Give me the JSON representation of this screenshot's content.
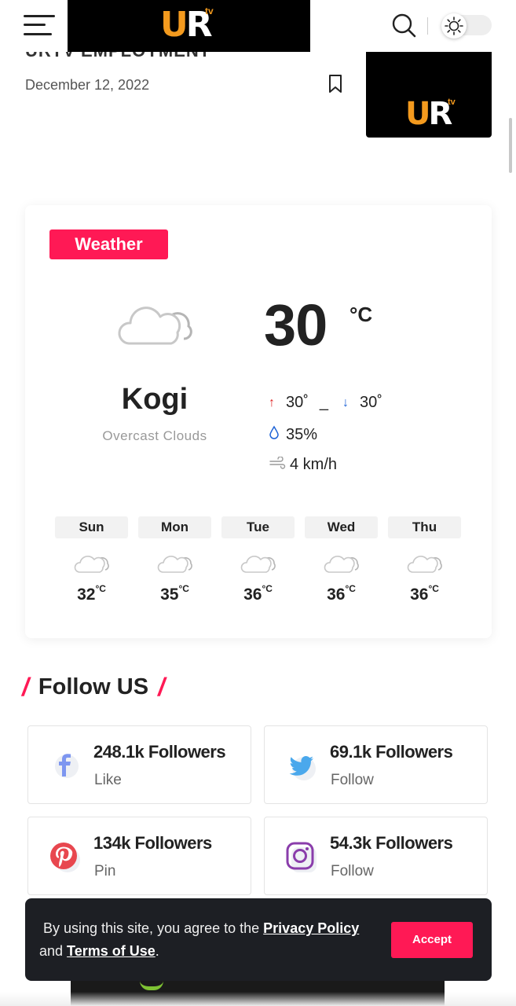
{
  "header": {
    "logo_u": "U",
    "logo_r": "R",
    "logo_tv": "tv",
    "menu_icon": "hamburger-menu-icon",
    "search_icon": "search-icon",
    "theme_icon": "sun-icon"
  },
  "post": {
    "title_cut": "URTV EMPLOYMENT",
    "date": "December 12, 2022",
    "bookmark_icon": "bookmark-icon"
  },
  "weather": {
    "badge": "Weather",
    "temperature": "30",
    "unit": "°C",
    "city": "Kogi",
    "description": "Overcast Clouds",
    "high": "30˚",
    "separator": "_",
    "low": "30˚",
    "humidity": "35%",
    "wind": "4 km/h",
    "forecast": [
      {
        "day": "Sun",
        "temp": "32",
        "unit": "°C"
      },
      {
        "day": "Mon",
        "temp": "35",
        "unit": "°C"
      },
      {
        "day": "Tue",
        "temp": "36",
        "unit": "°C"
      },
      {
        "day": "Wed",
        "temp": "36",
        "unit": "°C"
      },
      {
        "day": "Thu",
        "temp": "36",
        "unit": "°C"
      }
    ]
  },
  "follow": {
    "title": "Follow US",
    "items": [
      {
        "network": "facebook",
        "icon": "facebook-icon",
        "count": "248.1k Followers",
        "action": "Like",
        "color": "#3b5bdb"
      },
      {
        "network": "twitter",
        "icon": "twitter-icon",
        "count": "69.1k Followers",
        "action": "Follow",
        "color": "#1da1f2"
      },
      {
        "network": "pinterest",
        "icon": "pinterest-icon",
        "count": "134k Followers",
        "action": "Pin",
        "color": "#e60023"
      },
      {
        "network": "instagram",
        "icon": "instagram-icon",
        "count": "54.3k Followers",
        "action": "Follow",
        "color": "#833ab4"
      }
    ]
  },
  "cookie": {
    "text_before": "By using this site, you agree to the ",
    "privacy_link": "Privacy Policy",
    "text_middle": " and ",
    "terms_link": "Terms of Use",
    "text_after": ".",
    "accept": "Accept"
  },
  "colors": {
    "accent": "#ff1955",
    "logo_orange": "#f39a1e",
    "cookie_bg": "#1d1f24"
  }
}
